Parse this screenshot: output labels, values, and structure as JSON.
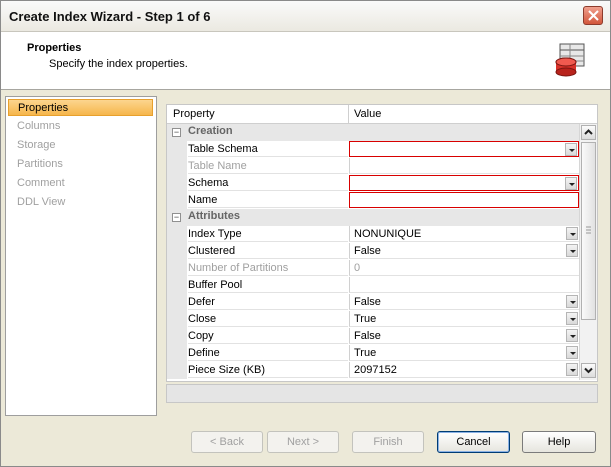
{
  "window": {
    "title": "Create Index Wizard - Step 1 of 6"
  },
  "header": {
    "title": "Properties",
    "subtitle": "Specify the index properties.",
    "icon": "database-table-icon"
  },
  "sidebar": {
    "items": [
      {
        "label": "Properties",
        "active": true
      },
      {
        "label": "Columns",
        "active": false
      },
      {
        "label": "Storage",
        "active": false
      },
      {
        "label": "Partitions",
        "active": false
      },
      {
        "label": "Comment",
        "active": false
      },
      {
        "label": "DDL View",
        "active": false
      }
    ]
  },
  "grid": {
    "columns": {
      "property": "Property",
      "value": "Value"
    },
    "categories": {
      "creation": "Creation",
      "attributes": "Attributes"
    },
    "rows": {
      "table_schema": {
        "name": "Table Schema",
        "value": ""
      },
      "table_name": {
        "name": "Table Name",
        "value": ""
      },
      "schema": {
        "name": "Schema",
        "value": ""
      },
      "name": {
        "name": "Name",
        "value": ""
      },
      "index_type": {
        "name": "Index Type",
        "value": "NONUNIQUE"
      },
      "clustered": {
        "name": "Clustered",
        "value": "False"
      },
      "num_partitions": {
        "name": "Number of Partitions",
        "value": "0"
      },
      "buffer_pool": {
        "name": "Buffer Pool",
        "value": ""
      },
      "defer": {
        "name": "Defer",
        "value": "False"
      },
      "close": {
        "name": "Close",
        "value": "True"
      },
      "copy": {
        "name": "Copy",
        "value": "False"
      },
      "define": {
        "name": "Define",
        "value": "True"
      },
      "piece_size": {
        "name": "Piece Size (KB)",
        "value": "2097152"
      }
    }
  },
  "buttons": {
    "back": "< Back",
    "next": "Next >",
    "finish": "Finish",
    "cancel": "Cancel",
    "help": "Help"
  },
  "colors": {
    "active_nav": "#f6b64c",
    "invalid_border": "#d80000",
    "close_button": "#d2563b"
  }
}
